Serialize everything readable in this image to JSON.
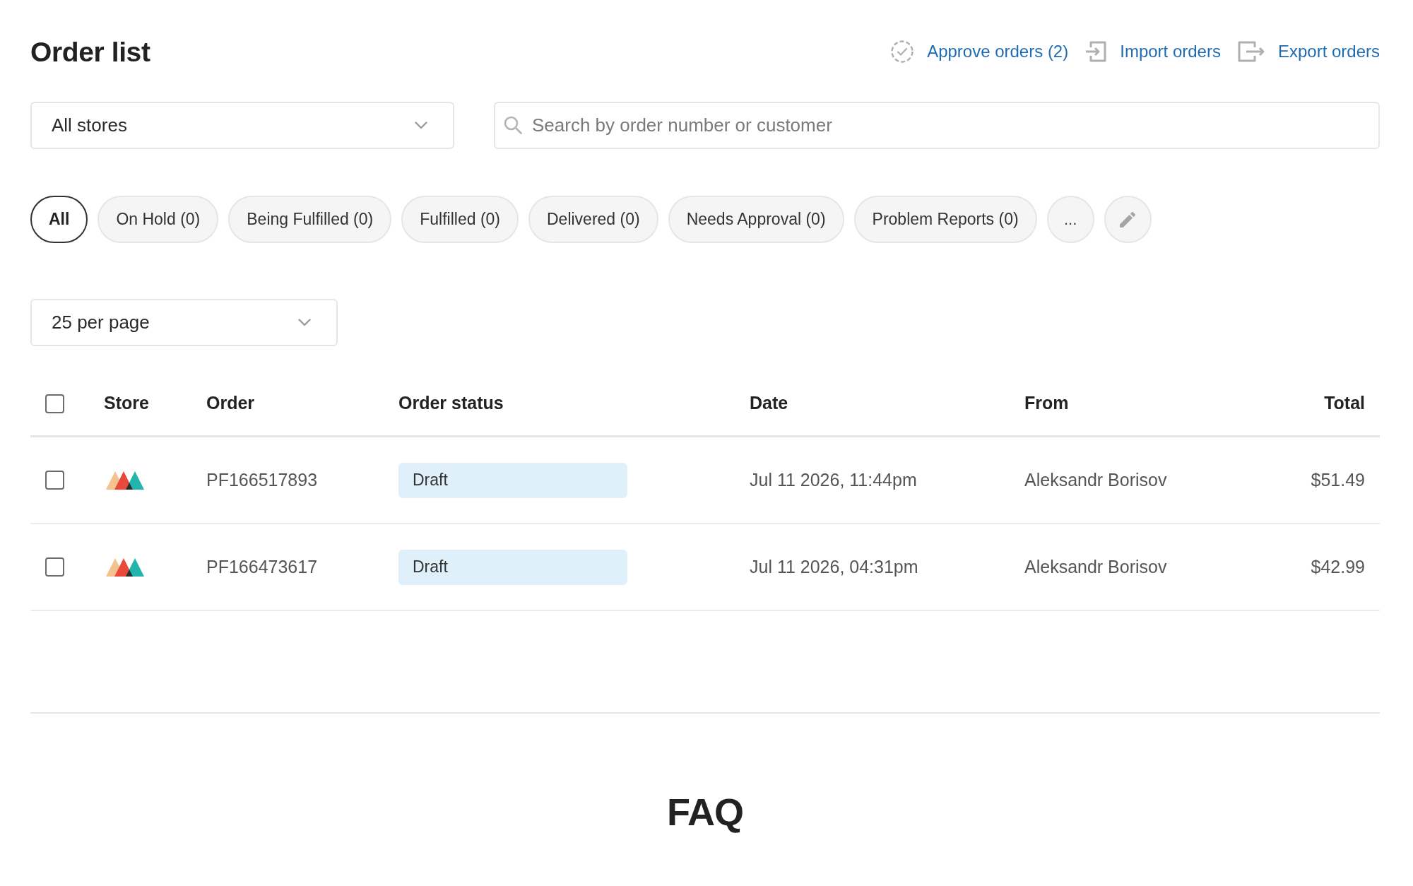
{
  "page": {
    "title": "Order list"
  },
  "actions": [
    {
      "kind": "approve",
      "label": "Approve orders (2)"
    },
    {
      "kind": "import",
      "label": "Import orders"
    },
    {
      "kind": "export",
      "label": "Export orders"
    }
  ],
  "store_filter": {
    "value": "All stores"
  },
  "search": {
    "placeholder": "Search by order number or customer"
  },
  "status_tabs": [
    {
      "label": "All",
      "selected": true
    },
    {
      "label": "On Hold (0)",
      "selected": false
    },
    {
      "label": "Being Fulfilled (0)",
      "selected": false
    },
    {
      "label": "Fulfilled (0)",
      "selected": false
    },
    {
      "label": "Delivered (0)",
      "selected": false
    },
    {
      "label": "Needs Approval (0)",
      "selected": false
    },
    {
      "label": "Problem Reports (0)",
      "selected": false
    }
  ],
  "more_tabs": {
    "label": "..."
  },
  "per_page": {
    "value": "25 per page"
  },
  "table": {
    "select_all": {
      "checked": false
    },
    "columns": [
      "Store",
      "Order",
      "Order status",
      "Date",
      "From",
      "Total"
    ],
    "rows": [
      {
        "checked": false,
        "order": "PF166517893",
        "status": "Draft",
        "date": "Jul 11 2026, 11:44pm",
        "from": "Aleksandr Borisov",
        "total": "$51.49"
      },
      {
        "checked": false,
        "order": "PF166473617",
        "status": "Draft",
        "date": "Jul 11 2026, 04:31pm",
        "from": "Aleksandr Borisov",
        "total": "$42.99"
      }
    ]
  },
  "faq": {
    "title": "FAQ"
  }
}
